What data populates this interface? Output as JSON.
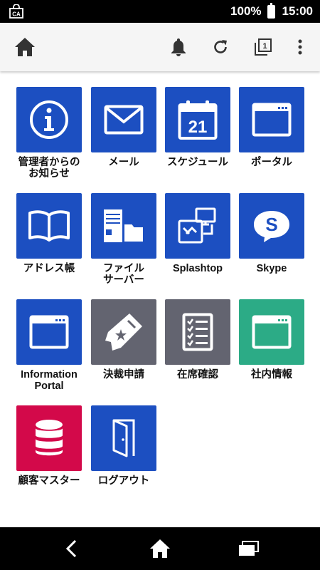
{
  "status_bar": {
    "left_icon": "ca-bag-icon",
    "left_icon_text": "CA",
    "battery_percent": "100%",
    "time": "15:00"
  },
  "toolbar": {
    "icons": [
      "home-icon",
      "bell-icon",
      "refresh-icon",
      "tabs-icon",
      "more-vert-icon"
    ],
    "tab_count": "1",
    "accent_color": "#333333"
  },
  "colors": {
    "blue": "#1c4fc1",
    "gray": "#636470",
    "green": "#2cab86",
    "red": "#d3094a"
  },
  "apps": [
    {
      "label": "管理者からの\nお知らせ",
      "icon": "info-icon",
      "color": "#1c4fc1"
    },
    {
      "label": "メール",
      "icon": "mail-icon",
      "color": "#1c4fc1"
    },
    {
      "label": "スケジュール",
      "icon": "calendar-icon",
      "color": "#1c4fc1",
      "icon_text": "21"
    },
    {
      "label": "ポータル",
      "icon": "browser-window-icon",
      "color": "#1c4fc1"
    },
    {
      "label": "アドレス帳",
      "icon": "book-icon",
      "color": "#1c4fc1"
    },
    {
      "label": "ファイル\nサーバー",
      "icon": "file-server-icon",
      "color": "#1c4fc1"
    },
    {
      "label": "Splashtop",
      "icon": "remote-desktop-icon",
      "color": "#1c4fc1"
    },
    {
      "label": "Skype",
      "icon": "skype-icon",
      "color": "#1c4fc1",
      "icon_text": "S"
    },
    {
      "label": "Information\nPortal",
      "icon": "browser-window-icon",
      "color": "#1c4fc1"
    },
    {
      "label": "決裁申請",
      "icon": "approval-ticket-icon",
      "color": "#636470"
    },
    {
      "label": "在席確認",
      "icon": "checklist-icon",
      "color": "#636470"
    },
    {
      "label": "社内情報",
      "icon": "browser-window-icon",
      "color": "#2cab86"
    },
    {
      "label": "顧客マスター",
      "icon": "database-icon",
      "color": "#d3094a"
    },
    {
      "label": "ログアウト",
      "icon": "logout-door-icon",
      "color": "#1c4fc1"
    }
  ],
  "nav_bar": {
    "icons": [
      "back-icon",
      "home-icon",
      "recent-apps-icon"
    ]
  }
}
